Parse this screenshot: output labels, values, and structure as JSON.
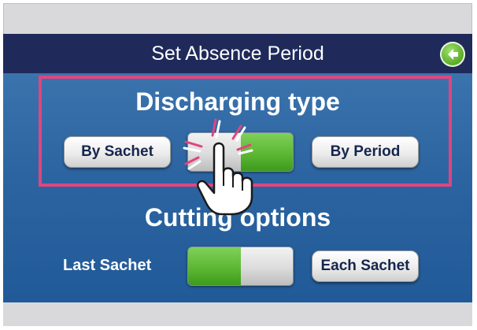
{
  "header": {
    "title": "Set Absence Period",
    "back_icon": "back-arrow-icon"
  },
  "discharging": {
    "title": "Discharging type",
    "left_button": "By Sachet",
    "right_button": "By Period"
  },
  "cutting": {
    "title": "Cutting options",
    "label": "Last Sachet",
    "right_button": "Each Sachet"
  },
  "colors": {
    "title_bar": "#1f2a5a",
    "panel": "#2c64a1",
    "highlight": "#e0457f",
    "toggle_on": "#5cb833"
  }
}
